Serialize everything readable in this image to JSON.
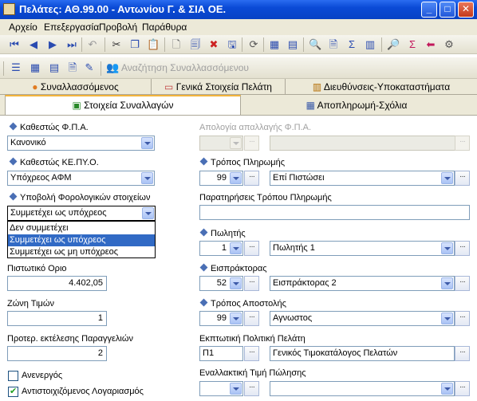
{
  "window": {
    "title": "Πελάτες: ΑΘ.99.00 - Αντωνίου Γ. & ΣΙΑ ΟΕ.",
    "controls": [
      "minimize",
      "maximize",
      "close"
    ]
  },
  "menu": [
    "Αρχείο",
    "Επεξεργασία",
    "Προβολή",
    "Παράθυρα"
  ],
  "toolbar2": {
    "search_label": "Αναζήτηση Συναλλασσόμενου"
  },
  "tabs_row1": [
    "Συναλλασσόμενος",
    "Γενικά Στοιχεία Πελάτη",
    "Διευθύνσεις-Υποκαταστήματα"
  ],
  "tabs_row2": [
    "Στοιχεία Συναλλαγών",
    "Αποπληρωμή-Σχόλια"
  ],
  "active_tab": "Στοιχεία Συναλλαγών",
  "left": {
    "vat_status_label": "Καθεστώς Φ.Π.Α.",
    "vat_status_value": "Κανονικό",
    "kepyo_label": "Καθεστώς ΚΕ.ΠΥ.Ο.",
    "kepyo_value": "Υπόχρεος ΑΦΜ",
    "tax_submit_label": "Υποβολή Φορολογικών στοιχείων",
    "tax_submit_value": "Συμμετέχει ως υπόχρεος",
    "tax_submit_options": [
      "Δεν συμμετέχει",
      "Συμμετέχει ως υπόχρεος",
      "Συμμετέχει ως μη υπόχρεος"
    ],
    "tax_submit_selected_index": 1,
    "credit_limit_label": "Πιστωτικό Οριο",
    "credit_limit_value": "4.402,05",
    "price_zone_label": "Ζώνη Τιμών",
    "price_zone_value": "1",
    "order_priority_label": "Προτερ. εκτέλεσης Παραγγελιών",
    "order_priority_value": "2",
    "inactive_label": "Ανενεργός",
    "inactive_checked": false,
    "linked_account_label": "Αντιστοιχιζόμενος Λογαριασμός",
    "linked_account_checked": true
  },
  "right": {
    "vat_exempt_label": "Απολογία απαλλαγής Φ.Π.Α.",
    "payment_method_label": "Τρόπος Πληρωμής",
    "payment_method_code": "99",
    "payment_method_value": "Επί Πιστώσει",
    "payment_notes_label": "Παρατηρήσεις Τρόπου Πληρωμής",
    "payment_notes_value": "",
    "seller_label": "Πωλητής",
    "seller_code": "1",
    "seller_value": "Πωλητής 1",
    "collector_label": "Εισπράκτορας",
    "collector_code": "52",
    "collector_value": "Εισπράκτορας 2",
    "shipping_label": "Τρόπος Αποστολής",
    "shipping_code": "99",
    "shipping_value": "Αγνωστος",
    "discount_policy_label": "Εκπτωτική Πολιτική Πελάτη",
    "discount_policy_code": "Π1",
    "discount_policy_value": "Γενικός Τιμοκατάλογος Πελατών",
    "alt_price_label": "Εναλλακτική Τιμή Πώλησης"
  },
  "colors": {
    "titlebar": "#0a4ad6",
    "tab_accent": "#f3b43b",
    "selection": "#316ac5",
    "label_bullet": "#4a6fb5"
  }
}
